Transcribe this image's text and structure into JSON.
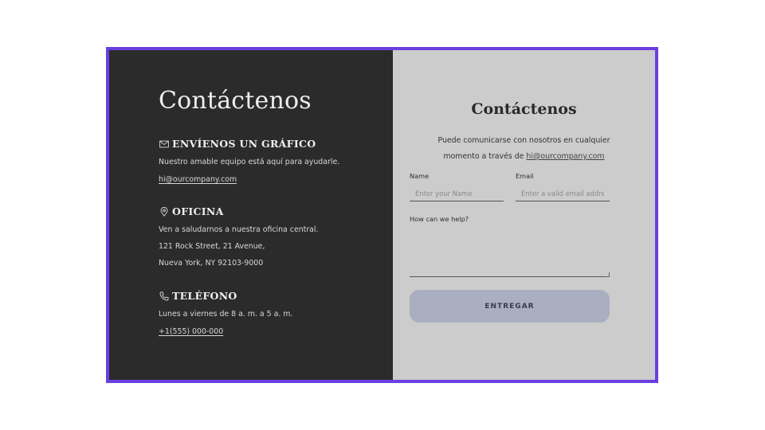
{
  "left": {
    "title": "Contáctenos",
    "chat": {
      "icon": "mail-icon",
      "heading": "ENVÍENOS UN GRÁFICO",
      "description": "Nuestro amable equipo está aquí para ayudarle.",
      "email": "hi@ourcompany.com"
    },
    "office": {
      "icon": "location-pin-icon",
      "heading": "OFICINA",
      "line1": "Ven a saludarnos a nuestra oficina central.",
      "line2": "121 Rock Street, 21 Avenue,",
      "line3": "Nueva York, NY 92103-9000"
    },
    "phone": {
      "icon": "phone-icon",
      "heading": "TELÉFONO",
      "hours": "Lunes a viernes de 8 a. m. a 5 a. m.",
      "number": "+1(555) 000-000"
    }
  },
  "right": {
    "title": "Contáctenos",
    "desc_line1": "Puede comunicarse con nosotros en cualquier",
    "desc_line2_prefix": "momento a través de ",
    "desc_email": "hi@ourcompany.com",
    "name_label": "Name",
    "name_placeholder": "Enter your Name",
    "email_label": "Email",
    "email_placeholder": "Enter a valid email address",
    "help_label": "How can we help?",
    "submit_label": "ENTREGAR"
  },
  "colors": {
    "frame_border": "#6a3fe0",
    "left_bg": "#2b2b2b",
    "right_bg": "#cccccc",
    "button_bg": "#a9aec0"
  }
}
